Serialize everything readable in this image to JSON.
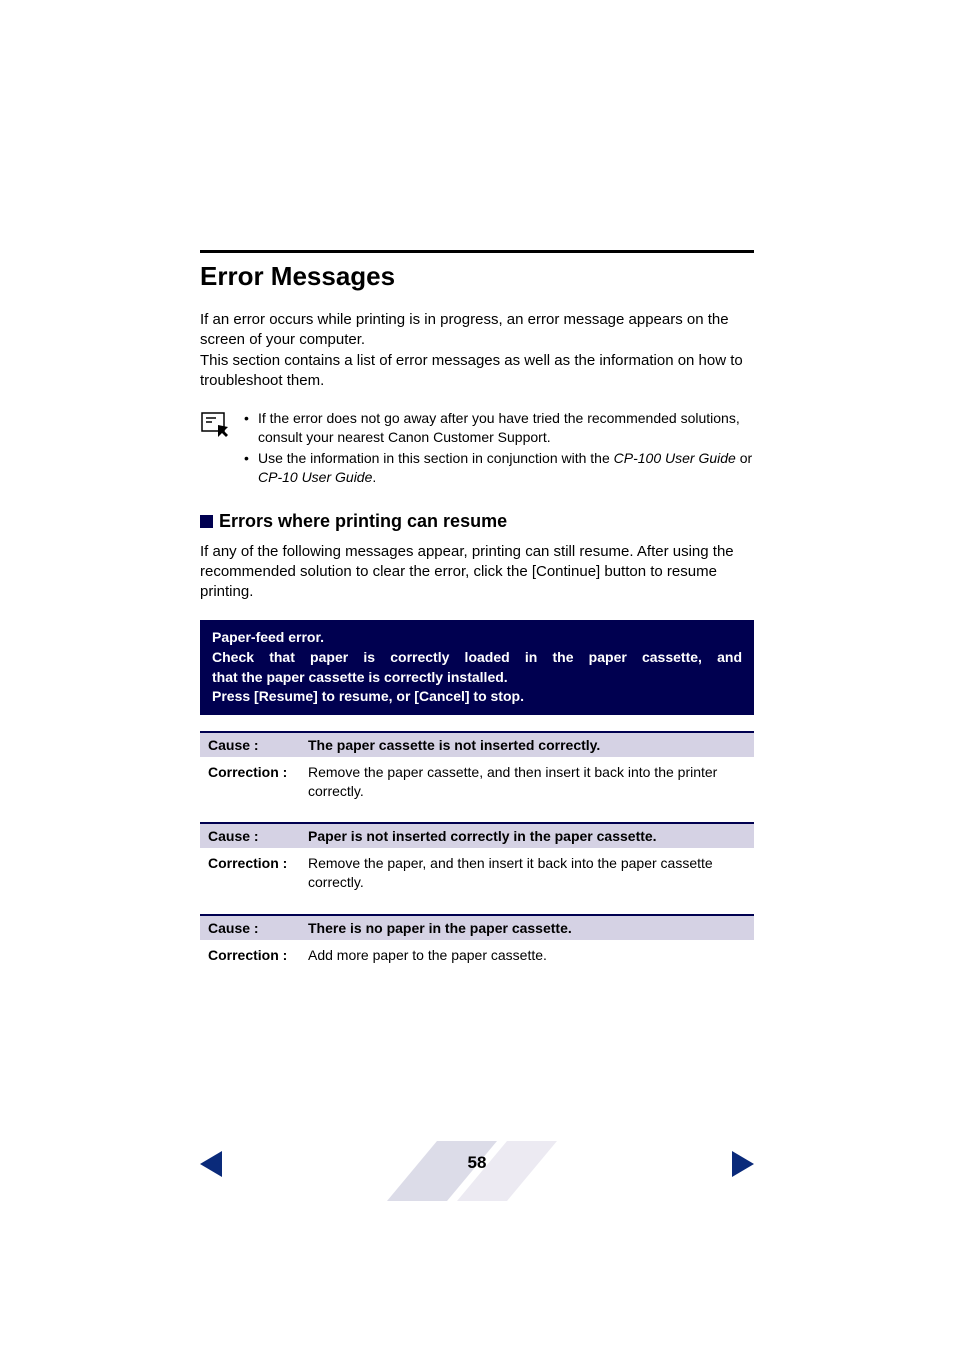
{
  "section": {
    "title": "Error Messages",
    "intro_p1": "If an error occurs while printing is in progress, an error message appears on the screen of your computer.",
    "intro_p2": "This section contains a list of error messages as well as the information on how to troubleshoot them."
  },
  "notes": {
    "item1": "If the error does not go away after you have tried the recommended solutions, consult your nearest Canon Customer Support.",
    "item2_prefix": "Use the information in this section in conjunction with the ",
    "item2_ref1": "CP-100 User Guide",
    "item2_mid": " or ",
    "item2_ref2": "CP-10 User Guide",
    "item2_suffix": "."
  },
  "subsection": {
    "title": "Errors where printing can resume",
    "intro": "If any of the following messages appear, printing can still resume. After using the recommended solution to clear the error, click the [Continue] button to resume printing."
  },
  "error_box": {
    "line1": "Paper-feed error.",
    "line2": "Check that paper is correctly loaded in the paper cassette, and that the paper cassette is correctly installed.",
    "line3": "Press [Resume] to resume, or [Cancel] to stop."
  },
  "labels": {
    "cause": "Cause :",
    "correction": "Correction :"
  },
  "blocks": [
    {
      "cause": "The paper cassette is not inserted correctly.",
      "correction": "Remove the paper cassette, and then insert it back into the printer correctly."
    },
    {
      "cause": "Paper is not inserted correctly in the paper cassette.",
      "correction": "Remove the paper, and then insert it back into the paper cassette correctly."
    },
    {
      "cause": "There is no paper in the paper cassette.",
      "correction": "Add more paper to the paper cassette."
    }
  ],
  "footer": {
    "page_number": "58"
  }
}
